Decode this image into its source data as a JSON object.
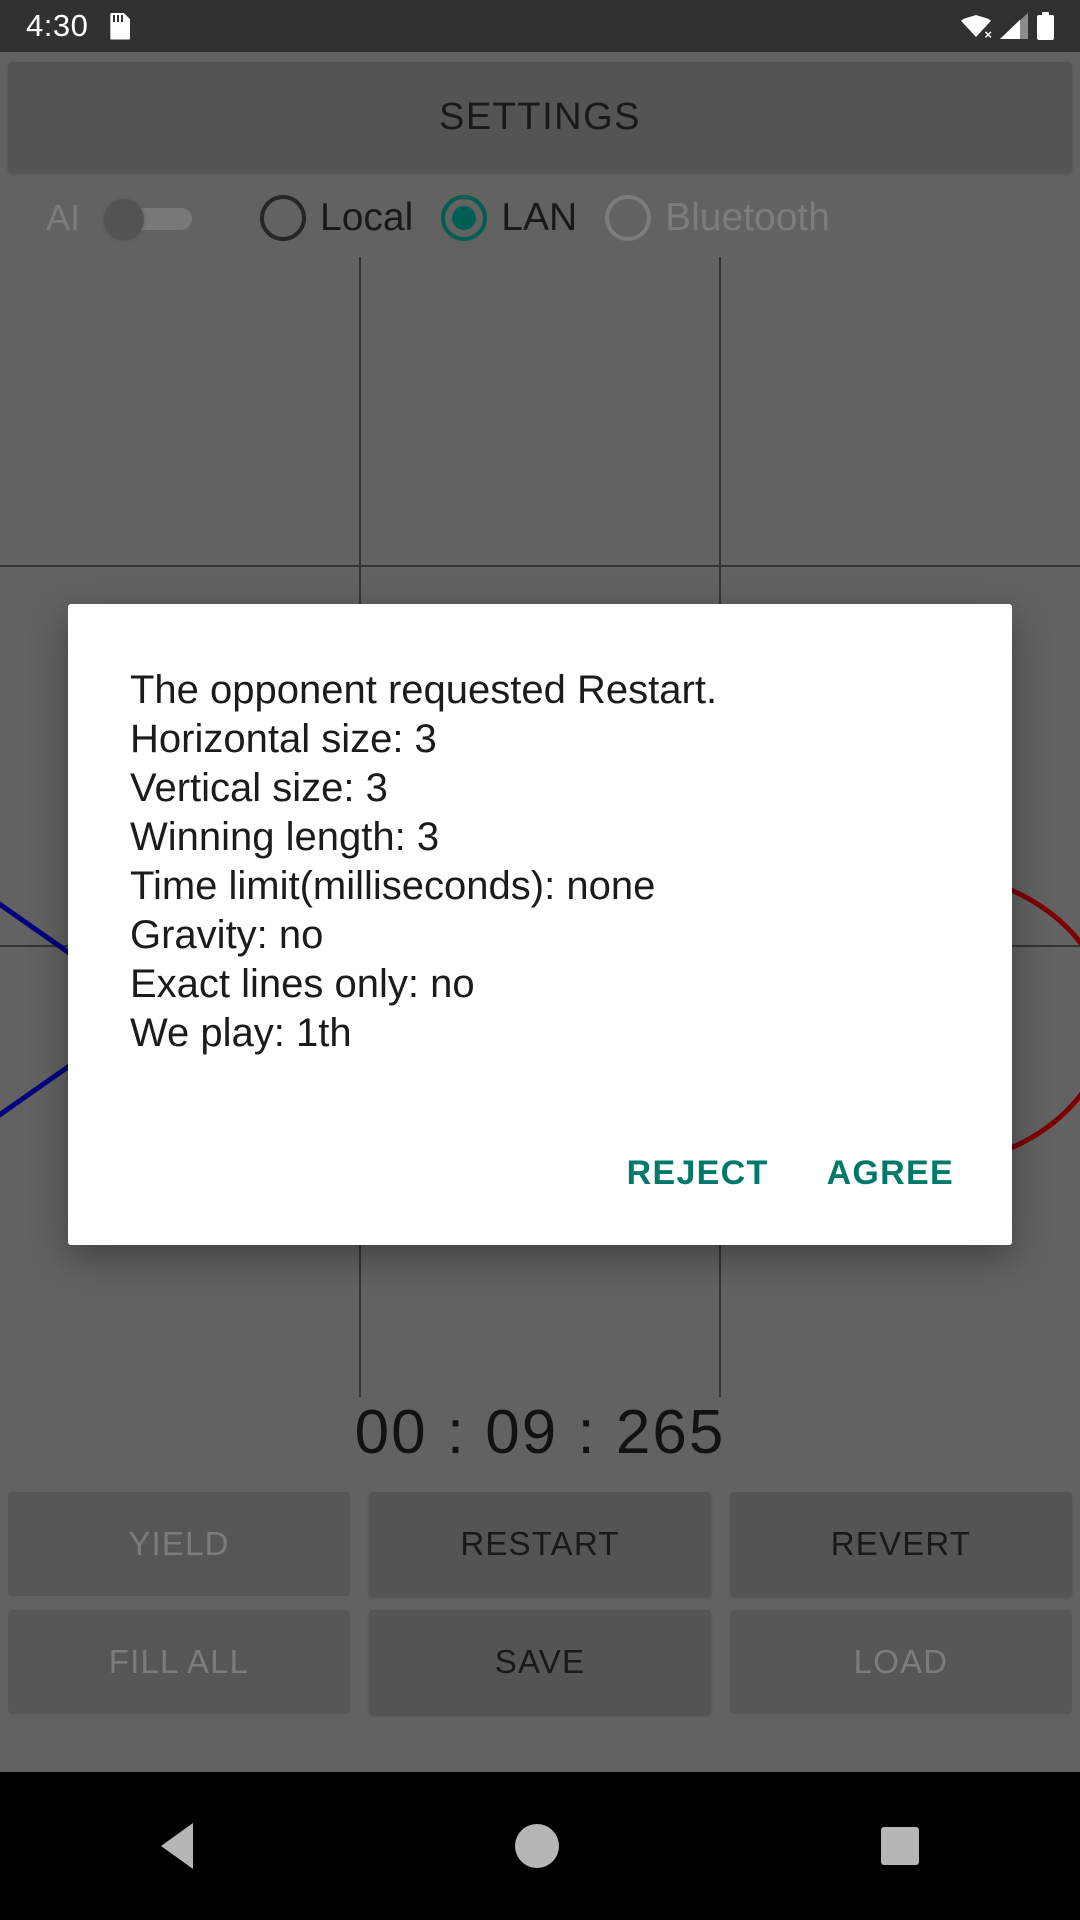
{
  "statusbar": {
    "time": "4:30",
    "icons": [
      "sd-card-icon",
      "wifi-off-icon",
      "signal-icon",
      "battery-icon"
    ]
  },
  "header": {
    "settings_label": "SETTINGS"
  },
  "mode_row": {
    "ai_label": "AI",
    "ai_enabled": false,
    "options": [
      {
        "label": "Local",
        "selected": false,
        "disabled": false
      },
      {
        "label": "LAN",
        "selected": true,
        "disabled": false
      },
      {
        "label": "Bluetooth",
        "selected": false,
        "disabled": true
      }
    ]
  },
  "board": {
    "columns": 3,
    "rows": 3,
    "marks": [
      {
        "type": "X",
        "cell": "bottom-left",
        "color": "#00008b"
      },
      {
        "type": "O",
        "cell": "bottom-right",
        "color": "#8b0000"
      }
    ]
  },
  "timer": {
    "value": "00 : 09 : 265"
  },
  "actions": {
    "row1": [
      {
        "label": "YIELD",
        "disabled": true
      },
      {
        "label": "RESTART",
        "disabled": false
      },
      {
        "label": "REVERT",
        "disabled": false
      }
    ],
    "row2": [
      {
        "label": "FILL ALL",
        "disabled": true
      },
      {
        "label": "SAVE",
        "disabled": false
      },
      {
        "label": "LOAD",
        "disabled": true
      }
    ]
  },
  "dialog": {
    "lines": [
      "The opponent requested Restart.",
      "Horizontal size: 3",
      "Vertical size: 3",
      "Winning length: 3",
      "Time limit(milliseconds): none",
      "Gravity: no",
      "Exact lines only: no",
      "We play: 1th"
    ],
    "reject_label": "REJECT",
    "agree_label": "AGREE",
    "accent_color": "#00796b"
  },
  "navbar": {
    "back": "back-icon",
    "home": "home-icon",
    "recents": "recents-icon"
  }
}
